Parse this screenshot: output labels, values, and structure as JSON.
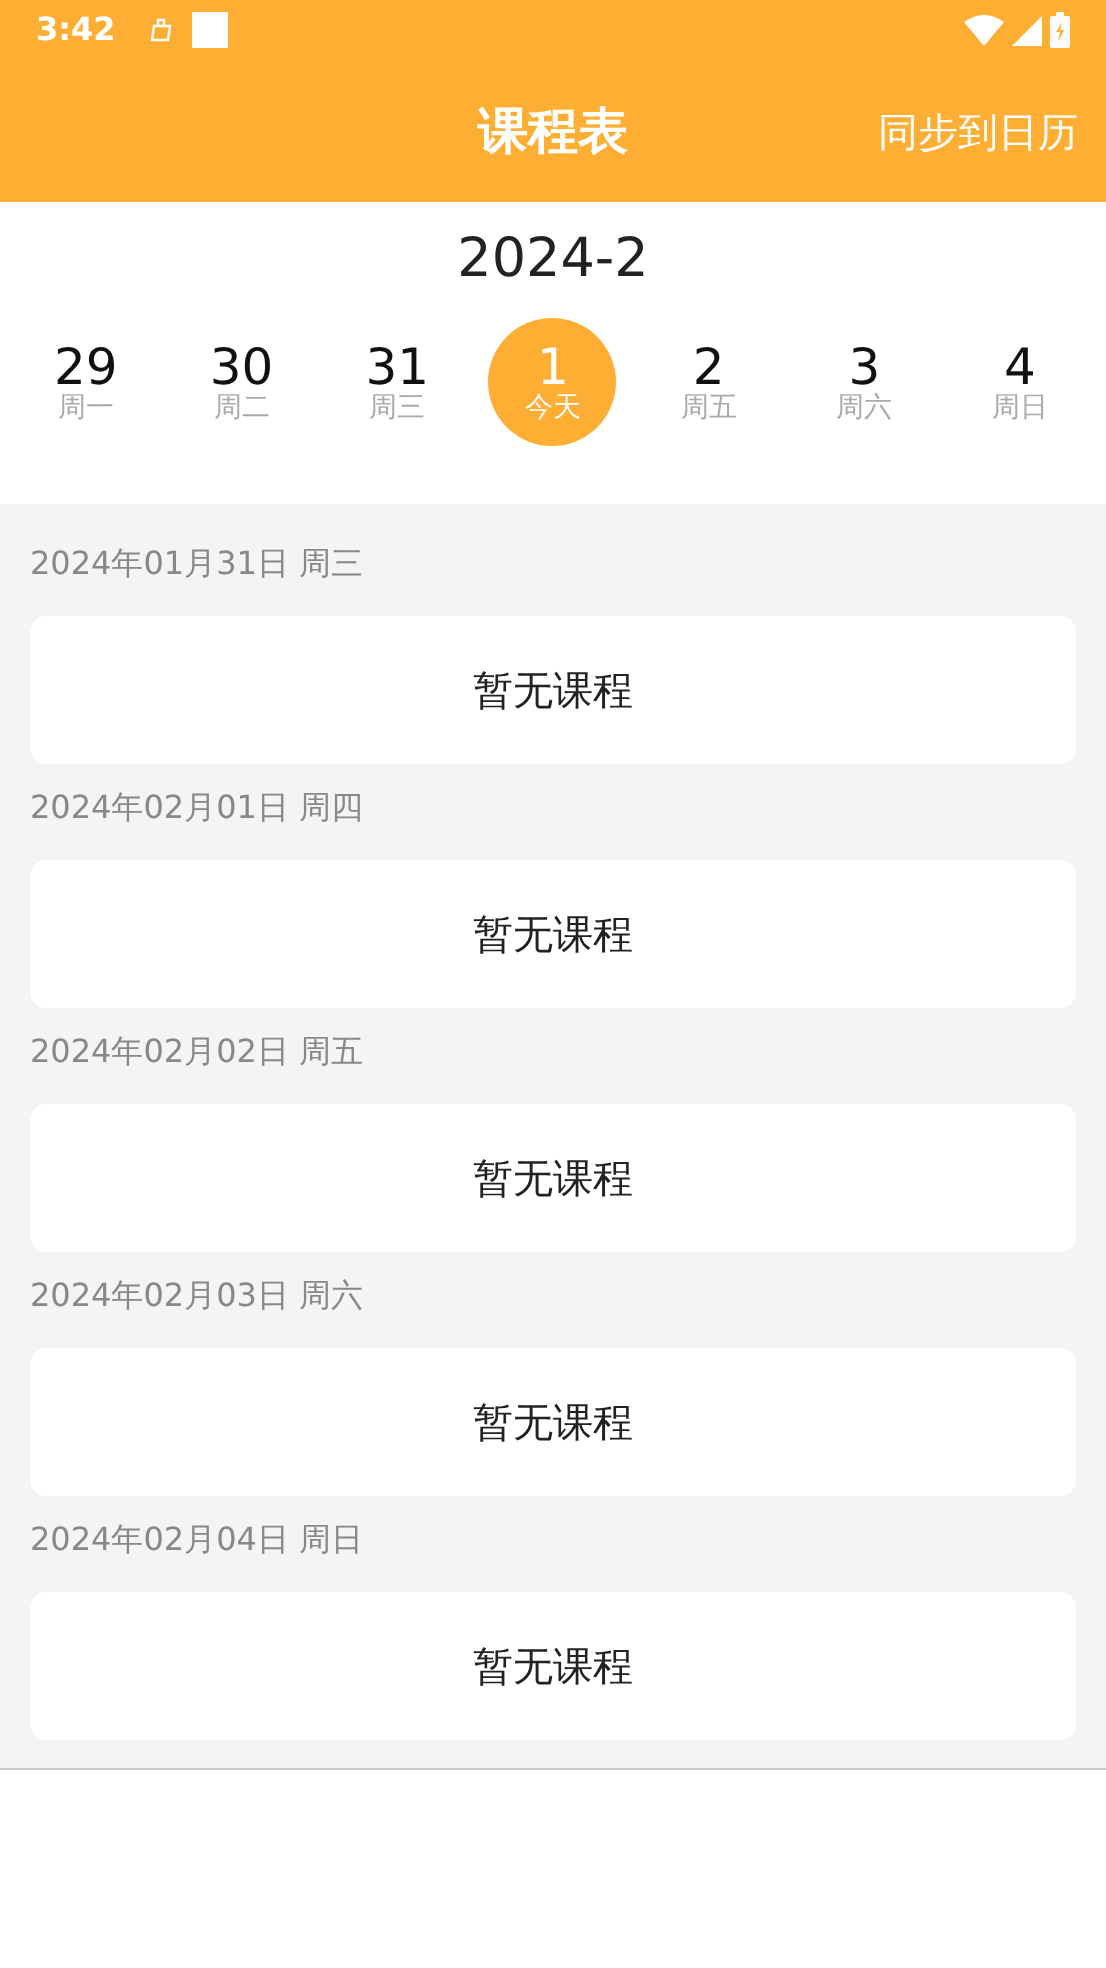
{
  "status_bar": {
    "time": "3:42"
  },
  "app_bar": {
    "title": "课程表",
    "action": "同步到日历"
  },
  "month": "2024-2",
  "week": [
    {
      "date": "29",
      "weekday": "周一",
      "selected": false
    },
    {
      "date": "30",
      "weekday": "周二",
      "selected": false
    },
    {
      "date": "31",
      "weekday": "周三",
      "selected": false
    },
    {
      "date": "1",
      "weekday": "今天",
      "selected": true
    },
    {
      "date": "2",
      "weekday": "周五",
      "selected": false
    },
    {
      "date": "3",
      "weekday": "周六",
      "selected": false
    },
    {
      "date": "4",
      "weekday": "周日",
      "selected": false
    }
  ],
  "days": [
    {
      "date_label": "2024年01月31日 周三",
      "message": "暂无课程"
    },
    {
      "date_label": "2024年02月01日 周四",
      "message": "暂无课程"
    },
    {
      "date_label": "2024年02月02日 周五",
      "message": "暂无课程"
    },
    {
      "date_label": "2024年02月03日 周六",
      "message": "暂无课程"
    },
    {
      "date_label": "2024年02月04日 周日",
      "message": "暂无课程"
    }
  ]
}
